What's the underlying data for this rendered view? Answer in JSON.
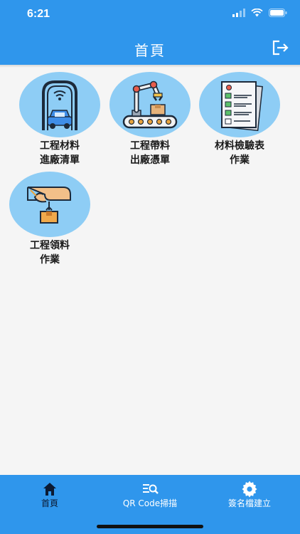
{
  "status_bar": {
    "time": "6:21"
  },
  "header": {
    "title": "首頁"
  },
  "tiles": [
    {
      "line1": "工程材料",
      "line2": "進廠清單",
      "icon": "vehicle-scan-gate-icon"
    },
    {
      "line1": "工程帶料",
      "line2": "出廠憑單",
      "icon": "robot-arm-conveyor-icon"
    },
    {
      "line1": "材料檢驗表",
      "line2": "作業",
      "icon": "checklist-document-icon"
    },
    {
      "line1": "工程領料",
      "line2": "作業",
      "icon": "hand-package-icon"
    }
  ],
  "tabbar": {
    "tabs": [
      {
        "label": "首頁",
        "icon": "home-icon",
        "active": true
      },
      {
        "label": "QR Code掃描",
        "icon": "qr-scan-icon",
        "active": false
      },
      {
        "label": "簽名檔建立",
        "icon": "gear-icon",
        "active": false
      }
    ]
  },
  "colors": {
    "primary": "#2f96ec",
    "tile_circle": "#8ecdf5",
    "active_tab": "#0b1a33",
    "inactive_tab": "#ffffff"
  }
}
